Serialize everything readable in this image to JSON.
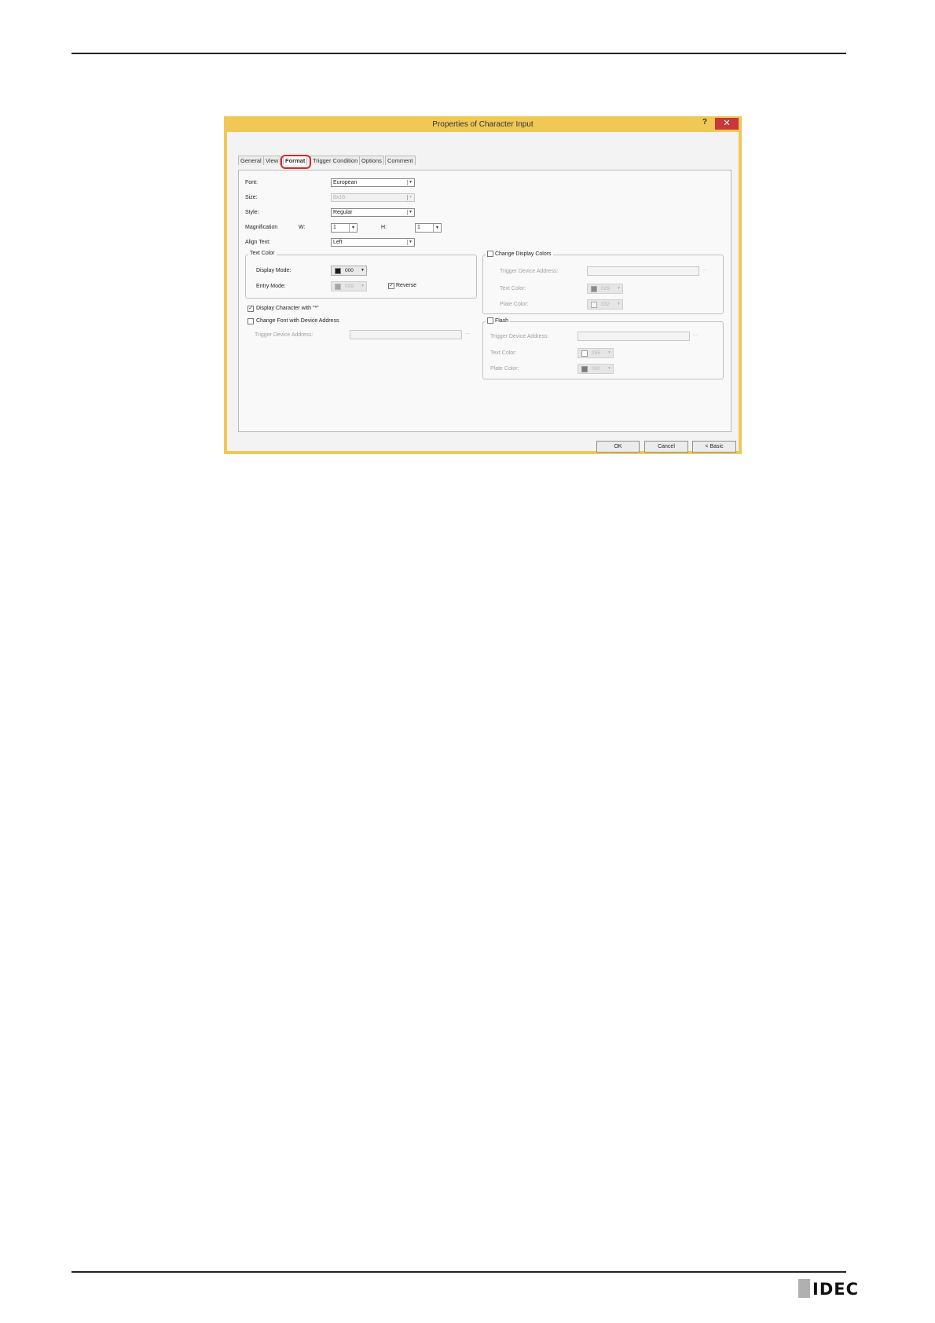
{
  "dialog": {
    "title": "Properties of Character Input",
    "help": "?",
    "close": "✕"
  },
  "tabs": [
    "General",
    "View",
    "Format",
    "Trigger Condition",
    "Options",
    "Comment"
  ],
  "active_tab": "Format",
  "format": {
    "font_label": "Font:",
    "font_value": "European",
    "size_label": "Size:",
    "size_value": "8x16",
    "style_label": "Style:",
    "style_value": "Regular",
    "magnification_label": "Magnification",
    "w_label": "W:",
    "w_value": "1",
    "h_label": "H:",
    "h_value": "1",
    "align_label": "Align Text:",
    "align_value": "Left"
  },
  "text_color": {
    "title": "Text Color",
    "display_mode_label": "Display Mode:",
    "display_mode_value": "000",
    "display_mode_color": "#1a1a1a",
    "entry_mode_label": "Entry Mode:",
    "entry_mode_value": "029",
    "entry_mode_color": "#a6a6a6",
    "reverse_label": "Reverse",
    "reverse_checked": true
  },
  "display_char": {
    "label": "Display Character with \"*\"",
    "checked": true
  },
  "change_font": {
    "label": "Change Font with Device Address",
    "checked": false,
    "trigger_label": "Trigger Device Address:",
    "trigger_value": "",
    "ellipsis": "..."
  },
  "change_colors": {
    "title": "Change Display Colors",
    "checked": false,
    "trigger_label": "Trigger Device Address:",
    "trigger_value": "",
    "ellipsis": "...",
    "text_color_label": "Text Color:",
    "text_color_value": "029",
    "text_color_swatch": "#8a8a8a",
    "plate_color_label": "Plate Color:",
    "plate_color_value": "032",
    "plate_color_swatch": "#f5f5f5"
  },
  "flash": {
    "title": "Flash",
    "checked": false,
    "trigger_label": "Trigger Device Address:",
    "trigger_value": "",
    "ellipsis": "...",
    "text_color_label": "Text Color:",
    "text_color_value": "255",
    "text_color_swatch": "#ffffff",
    "plate_color_label": "Plate Color:",
    "plate_color_value": "000",
    "plate_color_swatch": "#7a7a7a"
  },
  "buttons": {
    "ok": "OK",
    "cancel": "Cancel",
    "basic": "< Basic"
  },
  "page": {
    "logo_text": "IDEC"
  }
}
